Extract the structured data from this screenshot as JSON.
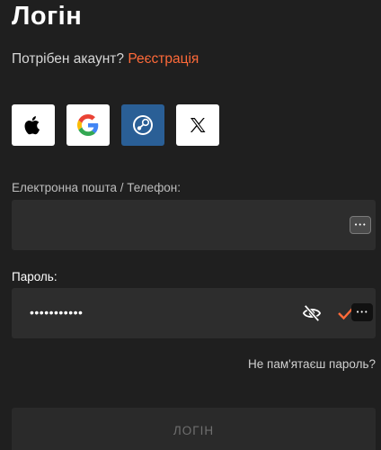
{
  "title": "Логін",
  "signup": {
    "prompt": "Потрібен акаунт?",
    "link": "Реєстрація"
  },
  "social": [
    {
      "name": "apple",
      "icon": "apple-icon"
    },
    {
      "name": "google",
      "icon": "google-icon"
    },
    {
      "name": "steam",
      "icon": "steam-icon"
    },
    {
      "name": "x",
      "icon": "x-icon"
    }
  ],
  "email": {
    "label": "Електронна пошта / Телефон:",
    "value": ""
  },
  "password": {
    "label": "Пароль:",
    "value": "•••••••••••"
  },
  "forgot_password": "Не пам'ятаєш пароль?",
  "login_button": "ЛОГІН",
  "colors": {
    "background": "#1f1f1f",
    "accent": "#ff6a39",
    "input_bg": "#2d2d2d",
    "steam_bg": "#2a5f96"
  }
}
